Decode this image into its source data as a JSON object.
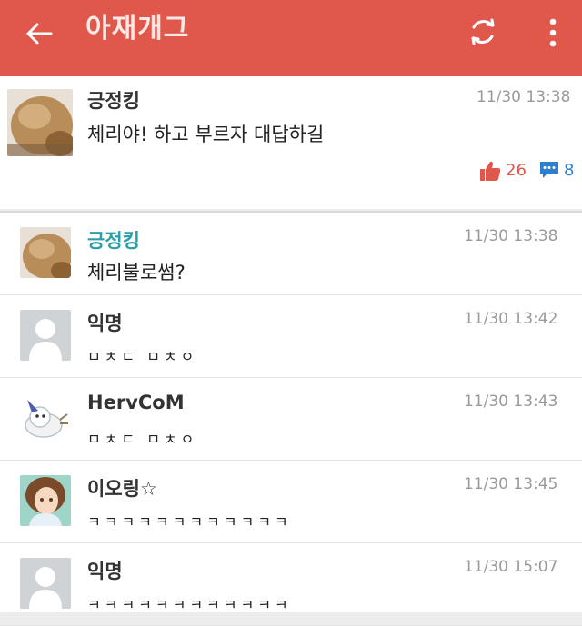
{
  "header": {
    "title": "아재개그",
    "back_icon": "back-arrow-icon",
    "refresh_icon": "refresh-icon",
    "menu_icon": "more-vert-icon",
    "color": "#e0584c"
  },
  "post": {
    "author": "긍정킹",
    "time": "11/30 13:38",
    "text": "체리야! 하고 부르자 대답하길",
    "likes": "26",
    "comments": "8"
  },
  "comments": [
    {
      "author": "긍정킹",
      "time": "11/30 13:38",
      "text": "체리불로썸?",
      "avatar": "photo",
      "highlight": true
    },
    {
      "author": "익명",
      "time": "11/30 13:42",
      "text": "ㅁㅊㄷ ㅁㅊㅇ",
      "avatar": "anonymous"
    },
    {
      "author": "HervCoM",
      "time": "11/30 13:43",
      "text": "ㅁㅊㄷ ㅁㅊㅇ",
      "avatar": "character"
    },
    {
      "author": "이오링☆",
      "time": "11/30 13:45",
      "text": "ㅋㅋㅋㅋㅋㅋㅋㅋㅋㅋㅋㅋ",
      "avatar": "anime"
    },
    {
      "author": "익명",
      "time": "11/30 15:07",
      "text": "ㅋㅋㅋㅋㅋㅋㅋㅋㅋㅋㅋㅋ",
      "avatar": "anonymous"
    }
  ]
}
